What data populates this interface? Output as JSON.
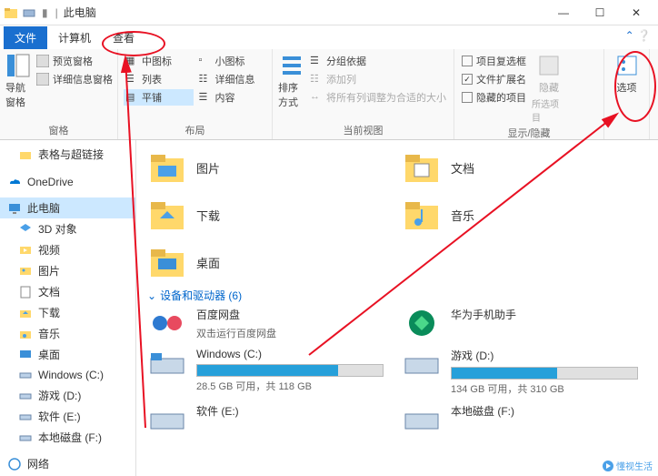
{
  "titlebar": {
    "location": "此电脑"
  },
  "window": {
    "min": "—",
    "max": "☐",
    "close": "✕"
  },
  "tabs": {
    "file": "文件",
    "computer": "计算机",
    "view": "查看"
  },
  "ribbon": {
    "panes": {
      "nav": "导航窗格",
      "preview": "预览窗格",
      "details": "详细信息窗格",
      "group_label": "窗格"
    },
    "layout": {
      "medium_icons": "中图标",
      "list": "列表",
      "tiles": "平铺",
      "small_icons": "小图标",
      "details": "详细信息",
      "content": "内容",
      "group_label": "布局"
    },
    "current_view": {
      "sort": "排序方式",
      "group_by": "分组依据",
      "add_columns": "添加列",
      "fit_columns": "将所有列调整为合适的大小",
      "group_label": "当前视图"
    },
    "show_hide": {
      "checkboxes": "项目复选框",
      "extensions": "文件扩展名",
      "hidden": "隐藏的项目",
      "hide_btn": "隐藏",
      "hide_btn_sub": "所选项目",
      "group_label": "显示/隐藏"
    },
    "options": {
      "label": "选项"
    }
  },
  "sidebar": {
    "items": [
      "表格与超链接",
      "OneDrive",
      "此电脑",
      "3D 对象",
      "视频",
      "图片",
      "文档",
      "下载",
      "音乐",
      "桌面",
      "Windows (C:)",
      "游戏 (D:)",
      "软件 (E:)",
      "本地磁盘 (F:)",
      "网络"
    ]
  },
  "content": {
    "folders": [
      {
        "name": "图片"
      },
      {
        "name": "文档"
      },
      {
        "name": "下载"
      },
      {
        "name": "音乐"
      },
      {
        "name": "桌面"
      }
    ],
    "devices_header": "设备和驱动器 (6)",
    "special": [
      {
        "name": "百度网盘",
        "sub": "双击运行百度网盘"
      },
      {
        "name": "华为手机助手",
        "sub": ""
      }
    ],
    "drives": [
      {
        "name": "Windows (C:)",
        "free": "28.5 GB 可用，共 118 GB",
        "fill": 76
      },
      {
        "name": "游戏 (D:)",
        "free": "134 GB 可用，共 310 GB",
        "fill": 57
      },
      {
        "name": "软件 (E:)",
        "free": "",
        "fill": 0
      },
      {
        "name": "本地磁盘 (F:)",
        "free": "",
        "fill": 0
      }
    ]
  },
  "watermark": "懂视生活"
}
